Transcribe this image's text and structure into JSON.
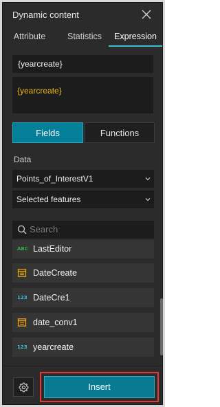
{
  "panel": {
    "title": "Dynamic content"
  },
  "tabs": [
    {
      "label": "Attribute",
      "active": false
    },
    {
      "label": "Statistics",
      "active": false
    },
    {
      "label": "Expression",
      "active": true
    }
  ],
  "expression": {
    "line_value": "{yearcreate}",
    "preview_value": "{yearcreate}"
  },
  "segmented": {
    "fields_label": "Fields",
    "functions_label": "Functions",
    "selected": "Fields"
  },
  "data_section": {
    "label": "Data",
    "source_value": "Points_of_InterestV1",
    "selection_value": "Selected features"
  },
  "search": {
    "placeholder": "Search"
  },
  "fields": [
    {
      "name": "LastEditor",
      "type_icon": "string-icon",
      "badge": "ABC"
    },
    {
      "name": "DateCreate",
      "type_icon": "date-icon",
      "badge": ""
    },
    {
      "name": "DateCre1",
      "type_icon": "number-icon",
      "badge": "123"
    },
    {
      "name": "date_conv1",
      "type_icon": "date-icon",
      "badge": ""
    },
    {
      "name": "yearcreate",
      "type_icon": "number-icon",
      "badge": "123"
    }
  ],
  "footer": {
    "insert_label": "Insert"
  },
  "colors": {
    "accent": "#3ec1d8",
    "button_primary": "#087b93",
    "highlight_outline": "#e53a3a",
    "expression_text": "#e9b91b",
    "date_icon": "#f2a900",
    "string_icon": "#35ac46"
  }
}
